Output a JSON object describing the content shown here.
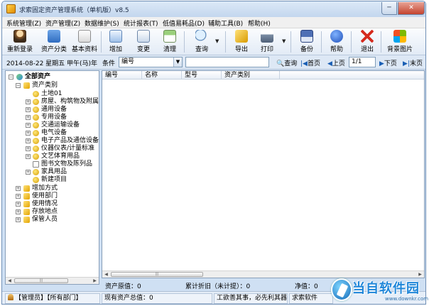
{
  "window": {
    "title": "求索固定资产管理系统（单机版）v8.5",
    "min": "─",
    "max": "□",
    "close": "✕"
  },
  "menu": [
    "系统管理(Z)",
    "资产管理(Z)",
    "数据维护(S)",
    "统计报表(T)",
    "低值易耗品(D)",
    "辅助工具(B)",
    "帮助(H)"
  ],
  "toolbar": {
    "relogin": "重新登录",
    "asset_category": "资产分类",
    "basic_info": "基本资料",
    "add": "增加",
    "change": "变更",
    "clean": "清理",
    "query": "查询",
    "export": "导出",
    "print": "打印",
    "backup": "备份",
    "help": "帮助",
    "exit": "退出",
    "background": "背景图片"
  },
  "filter": {
    "date": "2014-08-22 星期五 甲午(马)年",
    "condition_label": "条件",
    "condition_value": "编号",
    "query_label": "查询",
    "first_page": "首页",
    "prev_page": "上页",
    "page_value": "1/1",
    "next_page": "下页",
    "last_page": "末页"
  },
  "tree": {
    "root": "全部资产",
    "category_group": "资产类别",
    "categories": [
      "土地01",
      "房屋、构筑物及附属",
      "通用设备",
      "专用设备",
      "交通运输设备",
      "电气设备",
      "电子产品及通信设备",
      "仪器仪表/计量标准",
      "文艺体育用品",
      "图书文物及陈列品",
      "家具用品",
      "新建项目"
    ],
    "groups": [
      "增加方式",
      "使用部门",
      "使用情况",
      "存放地点",
      "保管人员"
    ]
  },
  "grid": {
    "columns": [
      "编号",
      "名称",
      "型号",
      "资产类别"
    ]
  },
  "summary": {
    "original_value": "资产原值：0",
    "depreciation": "累计折旧（未计提）：0",
    "net_value": "净值：0"
  },
  "status": {
    "user": "【管理员】【所有部门】",
    "total": "现有资产总值：0",
    "slogan": "工欲善其事，必先利其器",
    "company": "求索软件"
  },
  "watermark": {
    "text": "当自软件园",
    "url": "www.downkr.com"
  },
  "colors": {
    "titlebar": "#c3d6ee",
    "window_bg": "#cfe0f3",
    "accent": "#1f86d9"
  }
}
